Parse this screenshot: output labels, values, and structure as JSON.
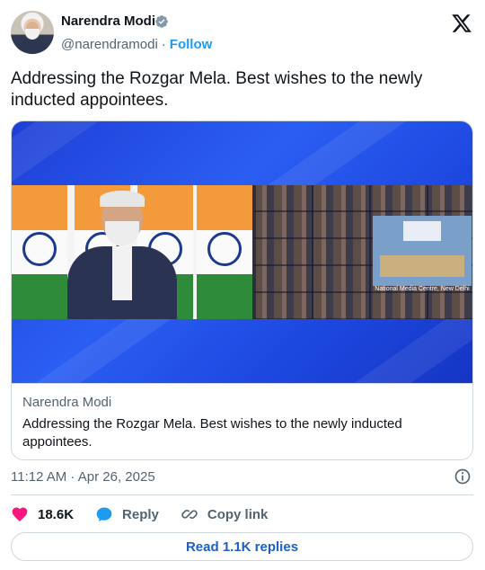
{
  "author": {
    "name": "Narendra Modi",
    "handle": "@narendramodi",
    "separator": "·",
    "follow_label": "Follow"
  },
  "tweet": {
    "text": "Addressing the Rozgar Mela. Best wishes to the newly inducted appointees."
  },
  "media": {
    "overlay_caption": "National Media Centre, New Delhi"
  },
  "link_card": {
    "source": "Narendra Modi",
    "title": "Addressing the Rozgar Mela. Best wishes to the newly inducted appointees."
  },
  "meta": {
    "timestamp": "11:12 AM · Apr 26, 2025"
  },
  "actions": {
    "likes": "18.6K",
    "reply_label": "Reply",
    "copy_link_label": "Copy link"
  },
  "footer": {
    "read_replies": "Read 1.1K replies"
  },
  "colors": {
    "accent": "#1d9bf0",
    "heart": "#f91880",
    "text": "#0f1419",
    "muted": "#536471",
    "border": "#cfd9de"
  },
  "icons": [
    "verified-badge-icon",
    "x-logo-icon",
    "info-icon",
    "heart-icon",
    "reply-icon",
    "copy-link-icon"
  ]
}
